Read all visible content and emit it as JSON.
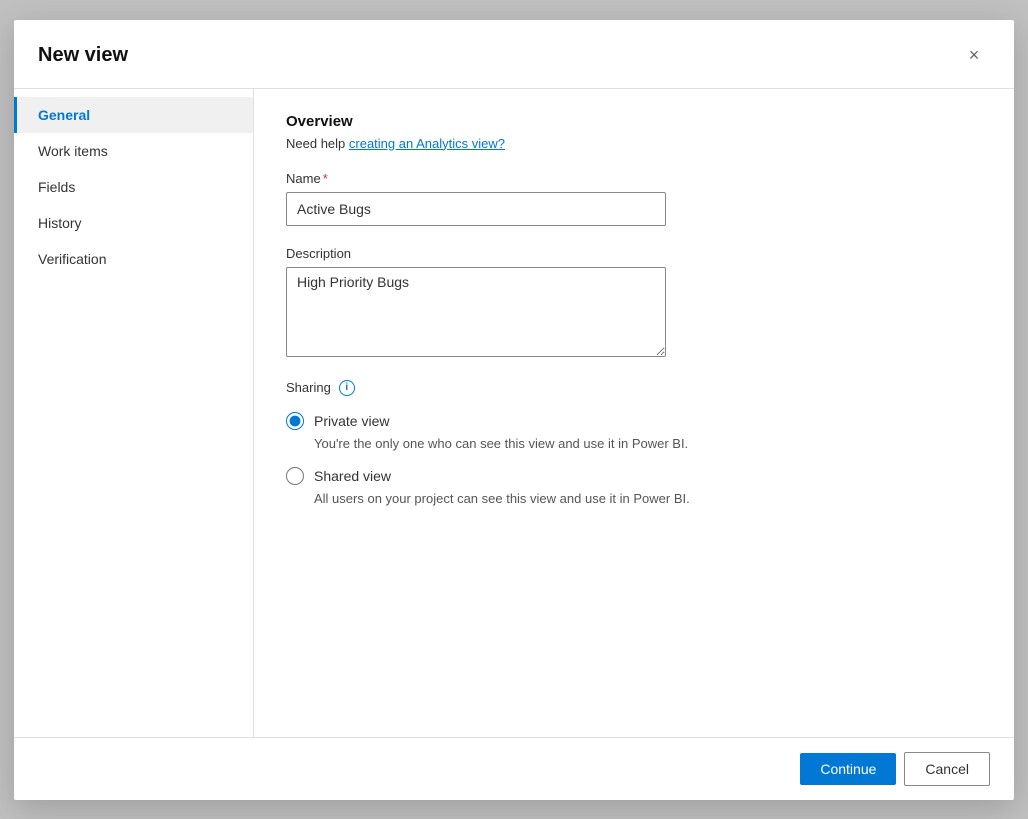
{
  "dialog": {
    "title": "New view",
    "close_label": "×"
  },
  "sidebar": {
    "items": [
      {
        "id": "general",
        "label": "General",
        "active": true
      },
      {
        "id": "work-items",
        "label": "Work items",
        "active": false
      },
      {
        "id": "fields",
        "label": "Fields",
        "active": false
      },
      {
        "id": "history",
        "label": "History",
        "active": false
      },
      {
        "id": "verification",
        "label": "Verification",
        "active": false
      }
    ]
  },
  "main": {
    "overview_title": "Overview",
    "help_prefix": "Need help ",
    "help_link_text": "creating an Analytics view?",
    "name_label": "Name",
    "name_required": "*",
    "name_value": "Active Bugs",
    "description_label": "Description",
    "description_value": "High Priority Bugs",
    "sharing_label": "Sharing",
    "info_icon": "i",
    "private_view_label": "Private view",
    "private_view_desc": "You're the only one who can see this view and use it in Power BI.",
    "shared_view_label": "Shared view",
    "shared_view_desc": "All users on your project can see this view and use it in Power BI."
  },
  "footer": {
    "continue_label": "Continue",
    "cancel_label": "Cancel"
  }
}
